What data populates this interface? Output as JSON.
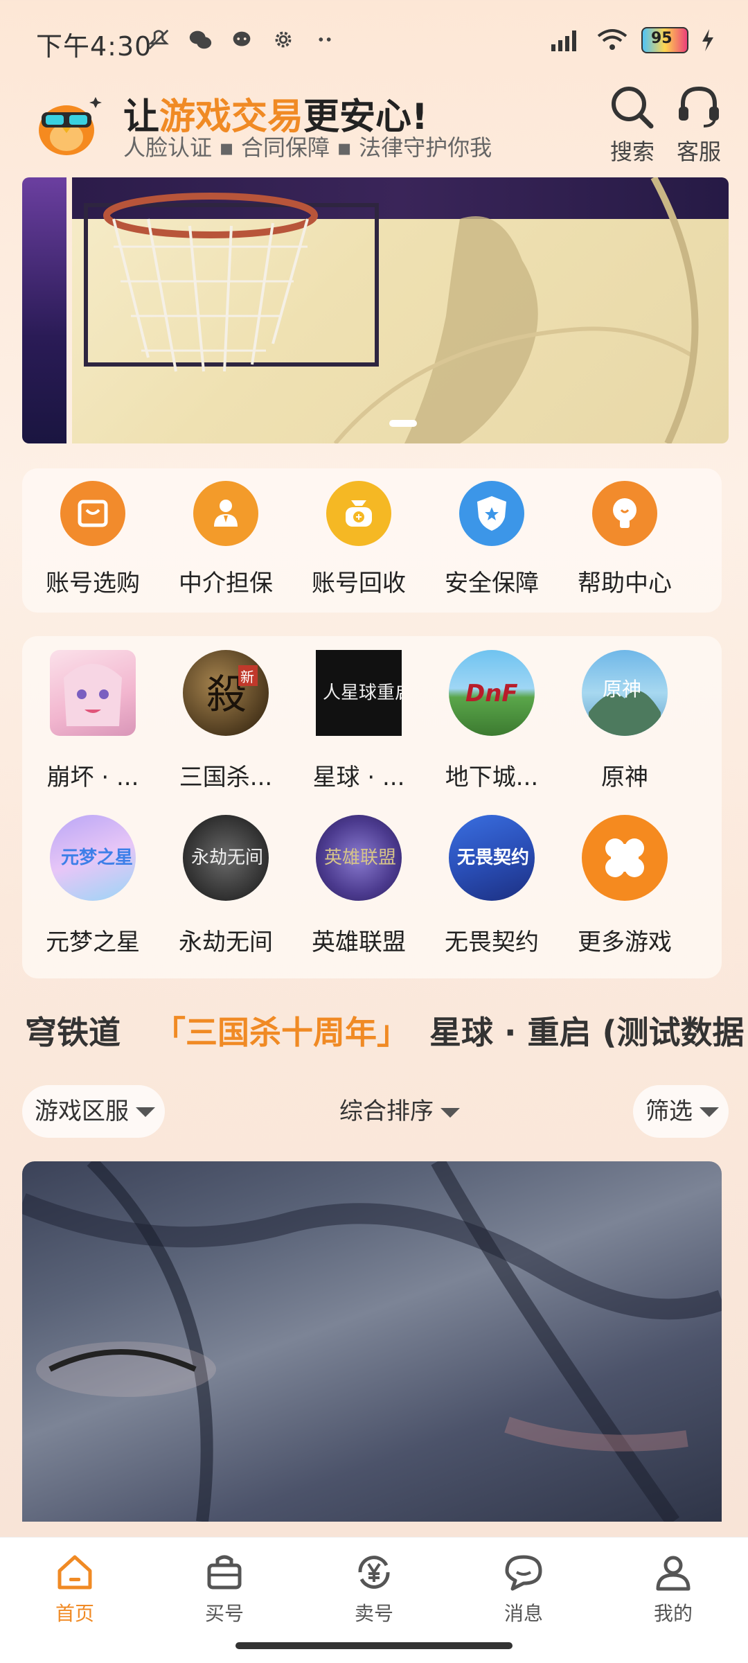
{
  "status_bar": {
    "time": "下午4:30",
    "battery": "95"
  },
  "header": {
    "slogan_prefix": "让",
    "slogan_highlight": "游戏交易",
    "slogan_suffix": "更安心!",
    "subline": "人脸认证 ▪ 合同保障 ▪ 法律守护你我",
    "search_label": "搜索",
    "service_label": "客服"
  },
  "quick_menu": [
    {
      "label": "账号选购",
      "icon": "shopping-bag-icon",
      "color": "#f28b2c"
    },
    {
      "label": "中介担保",
      "icon": "agent-icon",
      "color": "#f39b2a"
    },
    {
      "label": "账号回收",
      "icon": "money-bag-icon",
      "color": "#f5b824"
    },
    {
      "label": "安全保障",
      "icon": "shield-icon",
      "color": "#3c96e8"
    },
    {
      "label": "帮助中心",
      "icon": "lightbulb-icon",
      "color": "#f28b2c"
    }
  ],
  "games": [
    {
      "label": "崩坏 · ...",
      "icon": "honkai-icon"
    },
    {
      "label": "三国杀...",
      "icon": "sanguosha-icon"
    },
    {
      "label": "星球 · ...",
      "icon": "xingqiu-icon"
    },
    {
      "label": "地下城...",
      "icon": "dnf-icon"
    },
    {
      "label": "原神",
      "icon": "genshin-icon"
    },
    {
      "label": "元梦之星",
      "icon": "yuanmeng-icon"
    },
    {
      "label": "永劫无间",
      "icon": "naraka-icon"
    },
    {
      "label": "英雄联盟",
      "icon": "lol-icon"
    },
    {
      "label": "无畏契约",
      "icon": "valorant-icon"
    },
    {
      "label": "更多游戏",
      "icon": "more-games-icon"
    }
  ],
  "game_tabs": [
    {
      "label": "穹铁道",
      "active": false
    },
    {
      "label": "「三国杀十周年」",
      "active": true
    },
    {
      "label": "星球 · 重启 (测试数据",
      "active": false
    }
  ],
  "filters": {
    "server": "游戏区服",
    "sort": "综合排序",
    "filter": "筛选"
  },
  "bottom_nav": [
    {
      "label": "首页",
      "icon": "home-icon",
      "active": true
    },
    {
      "label": "买号",
      "icon": "buy-bag-icon",
      "active": false
    },
    {
      "label": "卖号",
      "icon": "sell-yen-icon",
      "active": false
    },
    {
      "label": "消息",
      "icon": "message-icon",
      "active": false
    },
    {
      "label": "我的",
      "icon": "profile-icon",
      "active": false
    }
  ],
  "colors": {
    "accent": "#f08a24"
  }
}
